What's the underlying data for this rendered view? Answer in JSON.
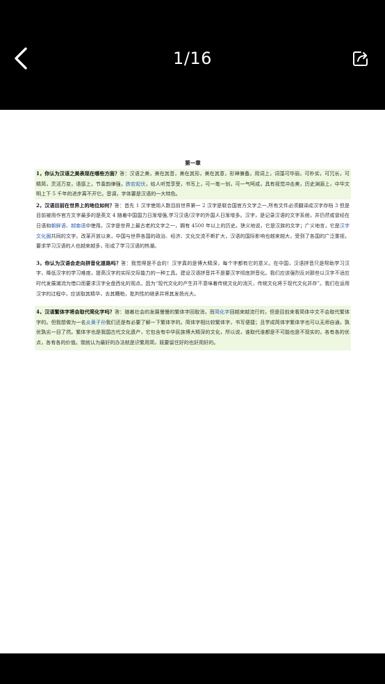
{
  "header": {
    "page_indicator": "1/16",
    "back_icon": "chevron-left-icon",
    "share_icon": "share-export-icon"
  },
  "doc": {
    "chapter_title": "第一章",
    "p1": {
      "question": "1，你认为汉语之美表现在哪些方面？",
      "t1": "答：汉语之美，美在其音，美在其形，美在其意，形神兼备。用词上，词藻可华丽，可朴实，可冗长，可精简，灵活万变，语感上，节奏韵律强，",
      "link1": "跌宕起伏",
      "t2": "，给人听觉享受，书写上，可一笔一划，可一气呵成，具有视觉冲击美，历史渊源上，中华文明上下 5 千年的进步离不开它。音调，字体要是汉语的一大特色。"
    },
    "p2": {
      "question": "2，汉语目前在世界上的地位如何？",
      "t1": "答：首先 1 汉字使用人数目前世界第一 2 汉字是联合国官方文字之一,所有文件必须翻译成汉字存档 3 但是目前被用作官方文字最多的是英文 4 随着中国国力日渐增强,学习汉语/汉字的外国人日渐增多。汉字，是记录汉语的文字系统，并仍然或曾经在日语和",
      "link1": "朝鲜语",
      "t2": "、",
      "link2": "越南语",
      "t3": "中使用。汉字是世界上最古老的文字之一，拥有 4500 年以上的历史。狭义地说，它是汉族的文字；广义地言，它是",
      "link3": "汉字文化圈",
      "t4": "共同的文字。改革开放以来，中国与世界各国的政治、经济、文化交流不断扩大，汉语的国际影响也越来越大，受到了各国的广泛重视，要求学习汉语的人也越来越多，形成了学习汉语的热潮。"
    },
    "p3": {
      "question": "3，你认为汉语会走向拼音化道路吗？",
      "t1": "答：我觉得是不会的！汉字真的是博大精深，每个字都有它的意义。在中国，汉语拼音只是帮助学习汉字，降低汉字的学习难度，提高汉字的实际交际能力的一种工具。建设汉语拼音并不是要汉字彻底拼音化。我们应该强烈反对那些以汉字不适应时代发展潮流为借口而要求汉字全盘西化的观点。因为“现代文化的产生并不意味着传统文化的消灭，传统文化将于现代文化并存”。我们在运用汉字的过程中，应该取其精华，去其糟粕，批判性的继承并将其发扬光大。"
    },
    "p4": {
      "question": "4，汉语繁体字将会取代简化字吗？",
      "t1": "答：随着社会的发展慢慢的繁体字回取消，而",
      "link1": "简化字",
      "t2": "回越来越流行的，但是目前来看简体中文不会取代繁体字的。但我想做为一名",
      "link2": "炎黄子孙",
      "t3": "我们还是有必要了解一下繁体字的。简体字相比较繁体字，书写便捷；且学成简体字繁体字也可以无师自通，孰优孰劣一目了然。繁体字也是我国古代文化遗产，它包含有中华民族博大精深的文化，所以说，谁取代谁都是不可能也是不现实的，各有各的优点，各有各的价值。我就认为最好的办法就是识繁用简，既要留住好的也好用好的。"
    }
  },
  "colors": {
    "bar": "#000000",
    "highlight": "#eef7df",
    "link": "#2a5db0"
  }
}
